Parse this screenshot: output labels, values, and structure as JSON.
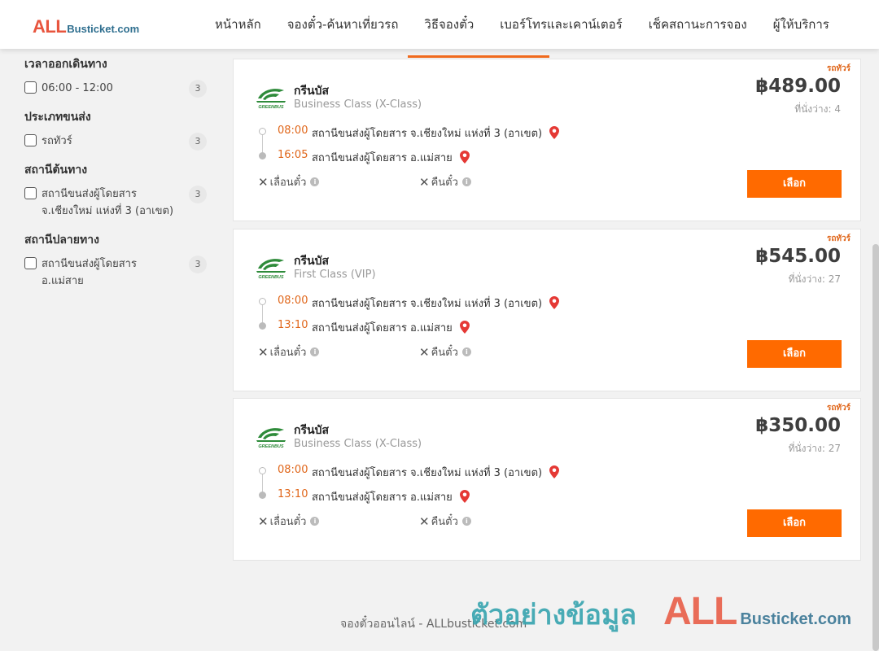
{
  "brand": {
    "all": "ALL",
    "rest": "Busticket.com"
  },
  "nav": [
    {
      "label": "หน้าหลัก"
    },
    {
      "label": "จองตั๋ว-ค้นหาเที่ยวรถ"
    },
    {
      "label": "วิธีจองตั๋ว"
    },
    {
      "label": "เบอร์โทรและเคาน์เตอร์"
    },
    {
      "label": "เช็คสถานะการจอง"
    },
    {
      "label": "ผู้ให้บริการ"
    }
  ],
  "filters": [
    {
      "title": "เวลาออกเดินทาง",
      "options": [
        {
          "label": "06:00 - 12:00",
          "count": "3"
        }
      ]
    },
    {
      "title": "ประเภทขนส่ง",
      "options": [
        {
          "label": "รถทัวร์",
          "count": "3"
        }
      ]
    },
    {
      "title": "สถานีต้นทาง",
      "options": [
        {
          "label": "สถานีขนส่งผู้โดยสาร จ.เชียงใหม่ แห่งที่ 3 (อาเขต)",
          "count": "3"
        }
      ]
    },
    {
      "title": "สถานีปลายทาง",
      "options": [
        {
          "label": "สถานีขนส่งผู้โดยสาร อ.แม่สาย",
          "count": "3"
        }
      ]
    }
  ],
  "results": [
    {
      "tag": "รถทัวร์",
      "operator": "กรีนบัส",
      "class": "Business Class (X-Class)",
      "price": "฿489.00",
      "seats": "ที่นั่งว่าง: 4",
      "depart_time": "08:00",
      "depart_station": "สถานีขนส่งผู้โดยสาร จ.เชียงใหม่ แห่งที่ 3 (อาเขต)",
      "arrive_time": "16:05",
      "arrive_station": "สถานีขนส่งผู้โดยสาร อ.แม่สาย",
      "reschedule": "เลื่อนตั๋ว",
      "refund": "คืนตั๋ว",
      "button": "เลือก"
    },
    {
      "tag": "รถทัวร์",
      "operator": "กรีนบัส",
      "class": "First Class (VIP)",
      "price": "฿545.00",
      "seats": "ที่นั่งว่าง: 27",
      "depart_time": "08:00",
      "depart_station": "สถานีขนส่งผู้โดยสาร จ.เชียงใหม่ แห่งที่ 3 (อาเขต)",
      "arrive_time": "13:10",
      "arrive_station": "สถานีขนส่งผู้โดยสาร อ.แม่สาย",
      "reschedule": "เลื่อนตั๋ว",
      "refund": "คืนตั๋ว",
      "button": "เลือก"
    },
    {
      "tag": "รถทัวร์",
      "operator": "กรีนบัส",
      "class": "Business Class (X-Class)",
      "price": "฿350.00",
      "seats": "ที่นั่งว่าง: 27",
      "depart_time": "08:00",
      "depart_station": "สถานีขนส่งผู้โดยสาร จ.เชียงใหม่ แห่งที่ 3 (อาเขต)",
      "arrive_time": "13:10",
      "arrive_station": "สถานีขนส่งผู้โดยสาร อ.แม่สาย",
      "reschedule": "เลื่อนตั๋ว",
      "refund": "คืนตั๋ว",
      "button": "เลือก"
    }
  ],
  "operator_logo_text": "GREENBUS",
  "footer": "จองตั๋วออนไลน์ - ALLbusticket.com",
  "watermark": {
    "sample_text": "ตัวอย่างข้อมูล",
    "all": "ALL",
    "rest": "Busticket.com"
  },
  "colors": {
    "accent": "#ff6a00",
    "time": "#e0661a",
    "brand_red": "#e8553e",
    "brand_teal": "#2f6f8f",
    "greenbus": "#2e8b3a"
  }
}
